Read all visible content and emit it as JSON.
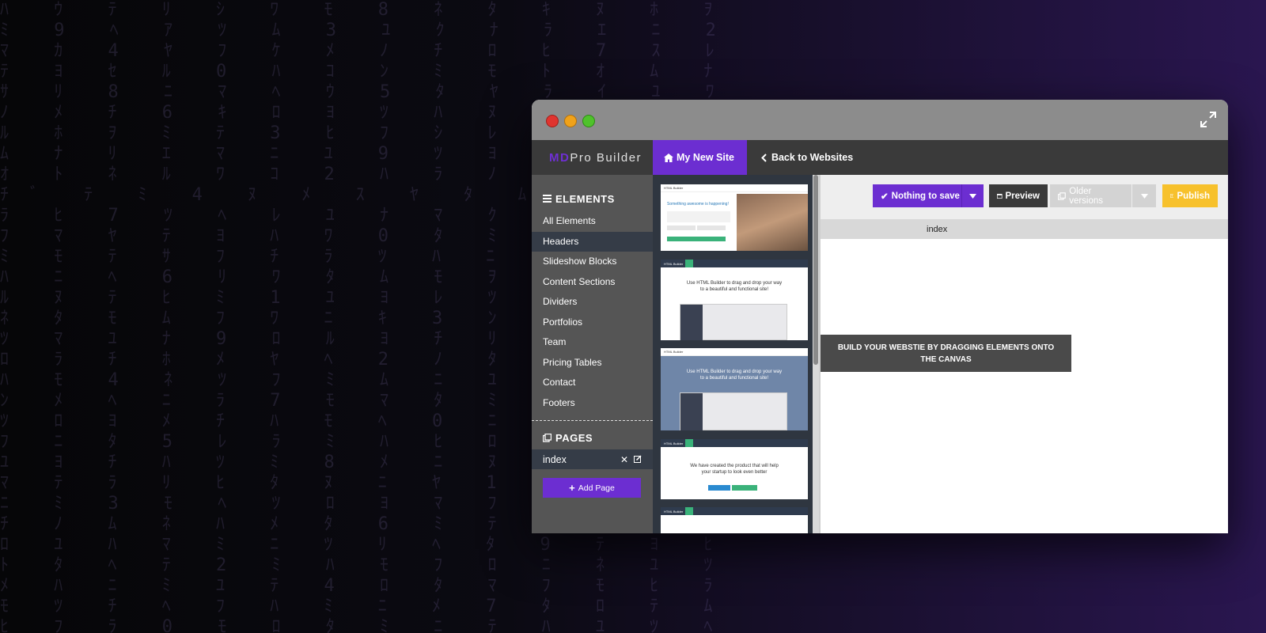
{
  "app": {
    "brand_prefix": "MD",
    "brand_suffix": "Pro Builder",
    "site_button": "My New Site",
    "back_button": "Back to Websites"
  },
  "sidebar": {
    "elements_title": "ELEMENTS",
    "items": [
      {
        "label": "All Elements",
        "active": false
      },
      {
        "label": "Headers",
        "active": true
      },
      {
        "label": "Slideshow Blocks",
        "active": false
      },
      {
        "label": "Content Sections",
        "active": false
      },
      {
        "label": "Dividers",
        "active": false
      },
      {
        "label": "Portfolios",
        "active": false
      },
      {
        "label": "Team",
        "active": false
      },
      {
        "label": "Pricing Tables",
        "active": false
      },
      {
        "label": "Contact",
        "active": false
      },
      {
        "label": "Footers",
        "active": false
      }
    ],
    "pages_title": "PAGES",
    "pages": [
      {
        "name": "index"
      }
    ],
    "add_page_label": "Add Page"
  },
  "toolbar": {
    "save_label": "Nothing to save",
    "preview_label": "Preview",
    "older_label": "Older versions",
    "publish_label": "Publish"
  },
  "canvas": {
    "tab_label": "index",
    "hint": "BUILD YOUR WEBSTIE BY DRAGGING ELEMENTS ONTO THE CANVAS"
  },
  "thumbnails": {
    "t1": {
      "brand": "HTML Builder",
      "headline": "Something awesome is happening!"
    },
    "t2": {
      "brand": "HTML Builder",
      "line1": "Use HTML Builder to drag and drop your way",
      "line2": "to a beautiful and functional site!"
    },
    "t3": {
      "brand": "HTML Builder",
      "line1": "Use HTML Builder to drag and drop your way",
      "line2": "to a beautiful and functional site!"
    },
    "t4": {
      "brand": "HTML Builder",
      "line1": "We have created the product that will help",
      "line2": "your startup to look even better"
    },
    "t5": {
      "brand": "HTML Builder"
    }
  },
  "colors": {
    "accent": "#6c2ed1",
    "publish": "#f7c12c",
    "sidebar": "#555555",
    "thumb_panel": "#2f3640"
  },
  "icons": [
    "expand-icon",
    "home-icon",
    "chevron-left-icon",
    "menu-icon",
    "pages-icon",
    "close-icon",
    "edit-icon",
    "plus-icon",
    "check-icon",
    "caret-down-icon",
    "preview-icon",
    "history-icon",
    "publish-icon"
  ]
}
